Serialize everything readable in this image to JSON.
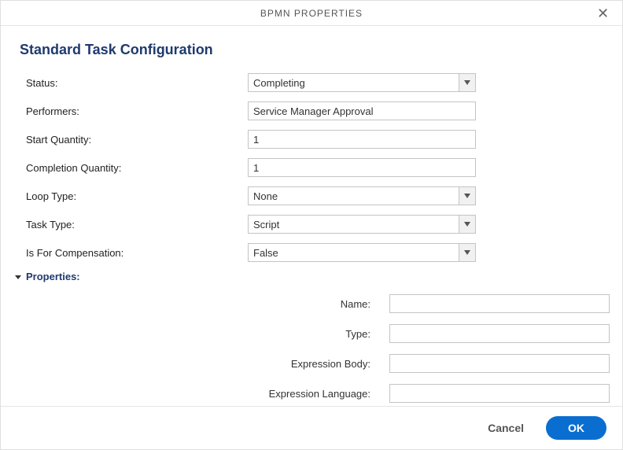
{
  "dialog": {
    "title": "BPMN PROPERTIES",
    "section_title": "Standard Task Configuration"
  },
  "fields": {
    "status": {
      "label": "Status:",
      "value": "Completing"
    },
    "performers": {
      "label": "Performers:",
      "value": "Service Manager Approval"
    },
    "start_quantity": {
      "label": "Start Quantity:",
      "value": "1"
    },
    "completion_quantity": {
      "label": "Completion Quantity:",
      "value": "1"
    },
    "loop_type": {
      "label": "Loop Type:",
      "value": "None"
    },
    "task_type": {
      "label": "Task Type:",
      "value": "Script"
    },
    "is_for_compensation": {
      "label": "Is For Compensation:",
      "value": "False"
    }
  },
  "properties_section": {
    "header": "Properties:",
    "name": {
      "label": "Name:",
      "value": ""
    },
    "type": {
      "label": "Type:",
      "value": ""
    },
    "expression_body": {
      "label": "Expression Body:",
      "value": ""
    },
    "expression_language": {
      "label": "Expression Language:",
      "value": ""
    }
  },
  "footer": {
    "cancel": "Cancel",
    "ok": "OK"
  }
}
